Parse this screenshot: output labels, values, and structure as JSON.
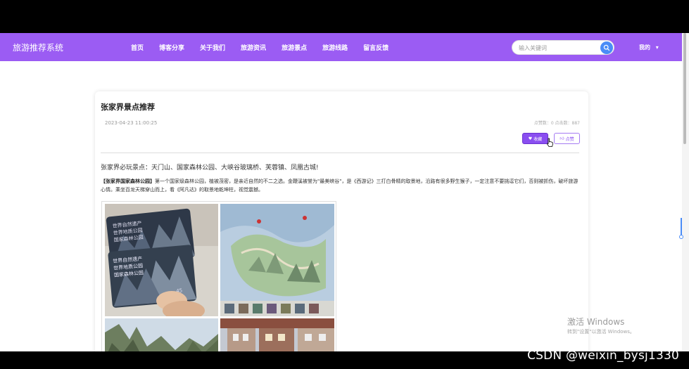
{
  "nav": {
    "brand": "旅游推荐系统",
    "menu": [
      "首页",
      "博客分享",
      "关于我们",
      "旅游资讯",
      "旅游景点",
      "旅游线路",
      "留言反馈"
    ],
    "search_placeholder": "输入关键词",
    "user_label": "我的",
    "bg_color": "#9b5cf3"
  },
  "article": {
    "title": "张家界景点推荐",
    "date": "2023-04-23 11:00:25",
    "stats": "点赞数：0   点击数：887",
    "fav_label": "收藏",
    "like_label": "点赞",
    "intro": "张家界必玩景点：天门山、国家森林公园、大峡谷玻璃桥、芙蓉镇、凤凰古城!",
    "para_bold": "【张家界国家森林公园】",
    "para_text": "第一个国家级森林公园，植被茂密，是亲近自然的不二之选。金鞭溪被誉为\"最美峡谷\"，是《西游记》三打白骨精的取景地，沿路有很多野生猴子，一定注意不要挑逗它们，否则被抓伤，破坏旅游心情。乘坐百龙天梯穿山而上，看《阿凡达》的取景地乾坤柱，视觉震撼。"
  },
  "overlay": {
    "activate_title": "激活 Windows",
    "activate_sub": "转到\"设置\"以激活 Windows。",
    "watermark": "CSDN @weixin_bysj1330"
  }
}
